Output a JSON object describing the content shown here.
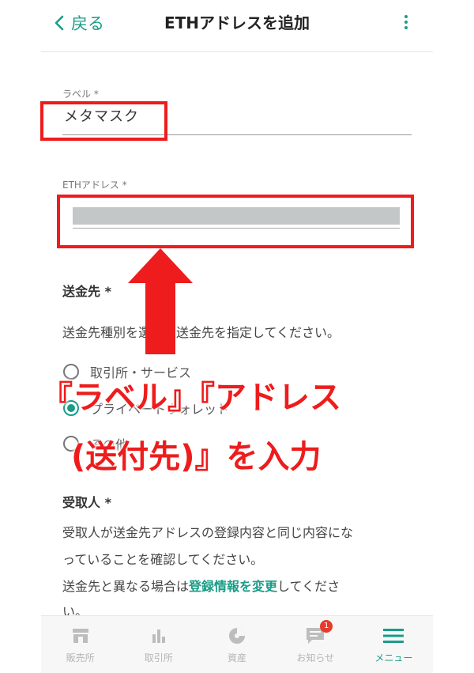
{
  "header": {
    "back_label": "戻る",
    "title": "ETHアドレスを追加"
  },
  "form": {
    "label_field": {
      "label": "ラベル *",
      "value": "メタマスク"
    },
    "address_field": {
      "label": "ETHアドレス *",
      "value": ""
    }
  },
  "destination": {
    "title": "送金先 *",
    "description": "送金先種別を選択し送金先を指定してください。",
    "options": [
      {
        "label": "取引所・サービス",
        "selected": false
      },
      {
        "label": "プライベートウォレット",
        "selected": true
      },
      {
        "label": "その他",
        "selected": false
      }
    ]
  },
  "recipient": {
    "title": "受取人 *",
    "line1": "受取人が送金先アドレスの登録内容と同じ内容にな",
    "line2": "っていることを確認してください。",
    "line3_prefix": "送金先と異なる場合は",
    "line3_link": "登録情報を変更",
    "line3_suffix": "してくださ",
    "line4": "い。"
  },
  "overlay": {
    "line1": "『ラベル』『アドレス",
    "line2": "(送付先)』を入力",
    "color": "#ee1c1c"
  },
  "bottom_nav": {
    "items": [
      {
        "label": "販売所",
        "icon": "store-icon",
        "active": false
      },
      {
        "label": "取引所",
        "icon": "bar-chart-icon",
        "active": false
      },
      {
        "label": "資産",
        "icon": "pie-chart-icon",
        "active": false
      },
      {
        "label": "お知らせ",
        "icon": "message-icon",
        "active": false,
        "badge": "1"
      },
      {
        "label": "メニュー",
        "icon": "menu-icon",
        "active": true
      }
    ]
  },
  "colors": {
    "accent": "#1a9c88",
    "highlight": "#ee1c1c",
    "badge": "#e53b2c"
  }
}
